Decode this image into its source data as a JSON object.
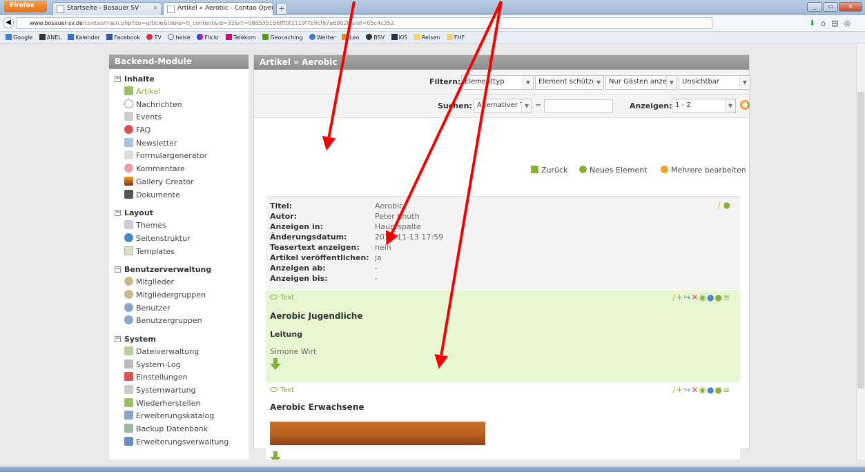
{
  "browser": {
    "app_label": "Firefox",
    "tabs": [
      {
        "label": "Startseite - Bosauer SV"
      },
      {
        "label": "Artikel » Aerobic - Contao Open Sour..."
      }
    ],
    "url_host": "www.bosauer-sv.de",
    "url_path": "/contao/main.php?do=article&table=tl_content&id=92&rt=08d535196fff0f2119f7b9cf67a6902b&ref=05c4c352",
    "bookmarks": [
      "Google",
      "ANEL",
      "Kalender",
      "Facebook",
      "TV",
      "heise",
      "Flickr",
      "Telekom",
      "Geocaching",
      "Wetter",
      "Leo",
      "BSV",
      "KIS",
      "Reisen",
      "FHF"
    ]
  },
  "sidebar": {
    "title": "Backend-Module",
    "groups": [
      {
        "title": "Inhalte",
        "items": [
          "Artikel",
          "Nachrichten",
          "Events",
          "FAQ",
          "Newsletter",
          "Formulargenerator",
          "Kommentare",
          "Gallery Creator",
          "Dokumente"
        ]
      },
      {
        "title": "Layout",
        "items": [
          "Themes",
          "Seitenstruktur",
          "Templates"
        ]
      },
      {
        "title": "Benutzerverwaltung",
        "items": [
          "Mitglieder",
          "Mitgliedergruppen",
          "Benutzer",
          "Benutzergruppen"
        ]
      },
      {
        "title": "System",
        "items": [
          "Dateiverwaltung",
          "System-Log",
          "Einstellungen",
          "Systemwartung",
          "Wiederherstellen",
          "Erweiterungskatalog",
          "Backup Datenbank",
          "Erweiterungsverwaltung"
        ]
      }
    ]
  },
  "main": {
    "title": "Artikel » Aerobic",
    "filter": {
      "label": "Filtern:",
      "selects": [
        "Elementtyp",
        "Element schützen",
        "Nur Gästen anzeigen",
        "Unsichtbar"
      ]
    },
    "search": {
      "label": "Suchen:",
      "field": "Alternativer Text",
      "operator": "=",
      "value": "",
      "show_label": "Anzeigen:",
      "show_value": "1 - 2"
    },
    "actions": {
      "back": "Zurück",
      "new": "Neues Element",
      "edit_multiple": "Mehrere bearbeiten"
    },
    "article": [
      {
        "key": "Titel:",
        "value": "Aerobic"
      },
      {
        "key": "Autor:",
        "value": "Peter Knuth"
      },
      {
        "key": "Anzeigen in:",
        "value": "Hauptspalte"
      },
      {
        "key": "Änderungsdatum:",
        "value": "2013-11-13 17:59"
      },
      {
        "key": "Teasertext anzeigen:",
        "value": "nein"
      },
      {
        "key": "Artikel veröffentlichen:",
        "value": "ja"
      },
      {
        "key": "Anzeigen ab:",
        "value": "-"
      },
      {
        "key": "Anzeigen bis:",
        "value": "-"
      }
    ],
    "elements": [
      {
        "type": "Text",
        "heading": "Aerobic Jugendliche",
        "subheading": "Leitung",
        "text": "Simone Wirt"
      },
      {
        "type": "Text",
        "heading": "Aerobic Erwachsene"
      }
    ]
  },
  "colors": {
    "accent_green": "#8ab03c",
    "header_gray": "#999999",
    "annotation_red": "#f20000",
    "element_highlight": "#e8f7d3"
  }
}
